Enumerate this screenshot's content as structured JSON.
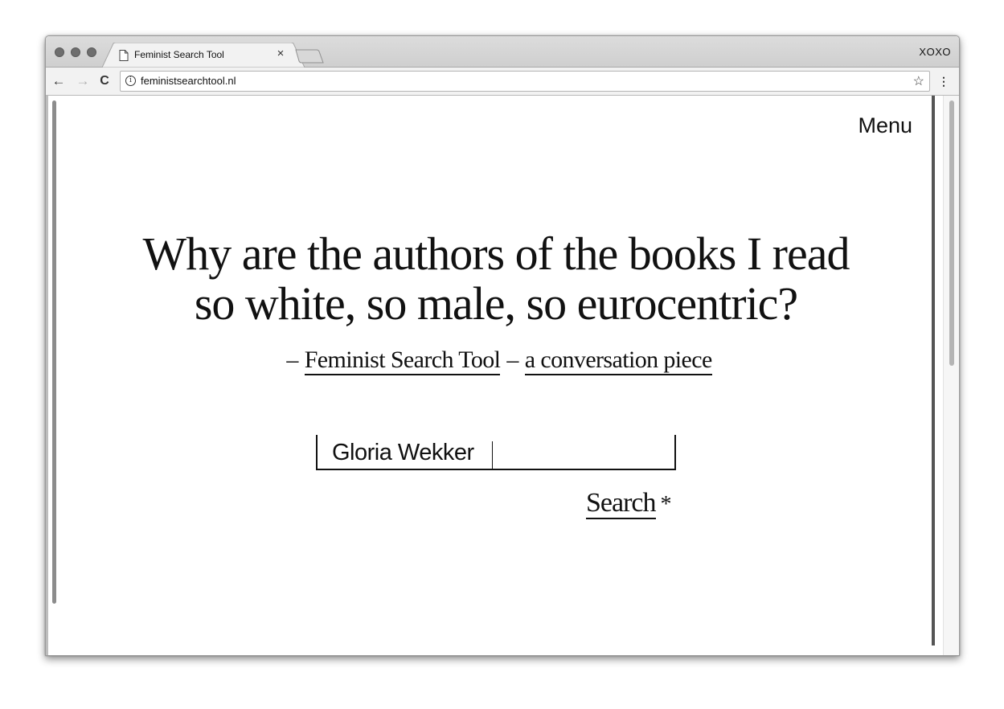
{
  "browser": {
    "tab_title": "Feminist Search Tool",
    "tab_close": "×",
    "profile": "XOXO",
    "url": "feministsearchtool.nl",
    "info_glyph": "i",
    "back_glyph": "←",
    "forward_glyph": "→",
    "reload_glyph": "C",
    "star_glyph": "☆",
    "menu_glyph": "⋮"
  },
  "page": {
    "menu_label": "Menu",
    "headline_line1": "Why are the authors of the books I read",
    "headline_line2": "so white, so male, so eurocentric?",
    "dash1": "–",
    "link_tool": "Feminist Search Tool",
    "dash2": "–",
    "link_conversation": "a conversation piece",
    "search_value": "Gloria Wekker",
    "search_button": "Search",
    "search_asterisk": "*"
  }
}
